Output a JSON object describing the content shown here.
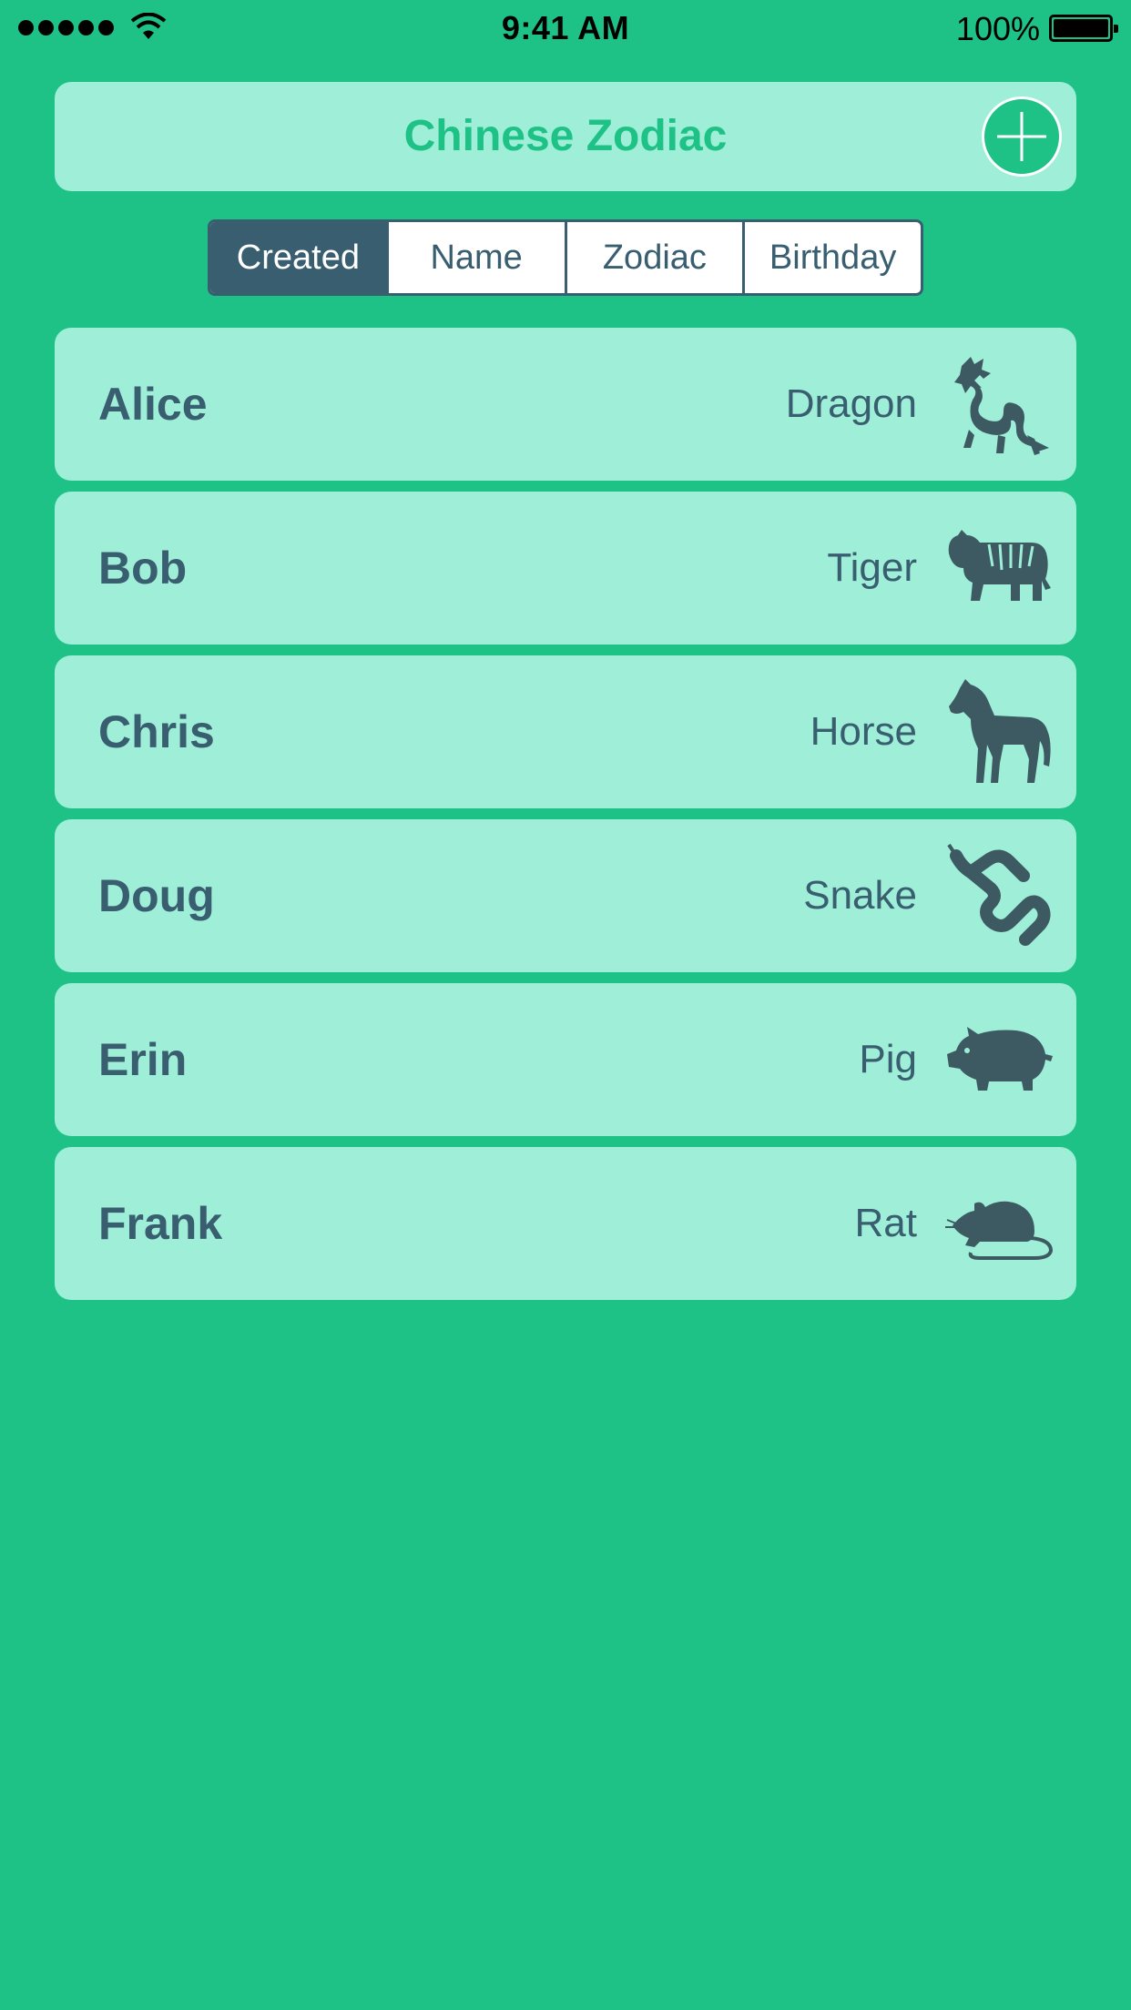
{
  "status_bar": {
    "time": "9:41 AM",
    "battery_percent": "100%",
    "signal_icon": "cellular-signal-icon",
    "wifi_icon": "wifi-icon",
    "battery_icon": "battery-icon"
  },
  "header": {
    "title": "Chinese Zodiac",
    "add_icon": "plus-icon"
  },
  "sort_tabs": [
    {
      "label": "Created",
      "selected": true
    },
    {
      "label": "Name",
      "selected": false
    },
    {
      "label": "Zodiac",
      "selected": false
    },
    {
      "label": "Birthday",
      "selected": false
    }
  ],
  "entries": [
    {
      "name": "Alice",
      "zodiac": "Dragon",
      "icon": "dragon-icon"
    },
    {
      "name": "Bob",
      "zodiac": "Tiger",
      "icon": "tiger-icon"
    },
    {
      "name": "Chris",
      "zodiac": "Horse",
      "icon": "horse-icon"
    },
    {
      "name": "Doug",
      "zodiac": "Snake",
      "icon": "snake-icon"
    },
    {
      "name": "Erin",
      "zodiac": "Pig",
      "icon": "pig-icon"
    },
    {
      "name": "Frank",
      "zodiac": "Rat",
      "icon": "rat-icon"
    }
  ],
  "colors": {
    "background": "#1ec287",
    "card": "#9eeed8",
    "text_dark": "#385e70",
    "accent": "#1ec287"
  }
}
